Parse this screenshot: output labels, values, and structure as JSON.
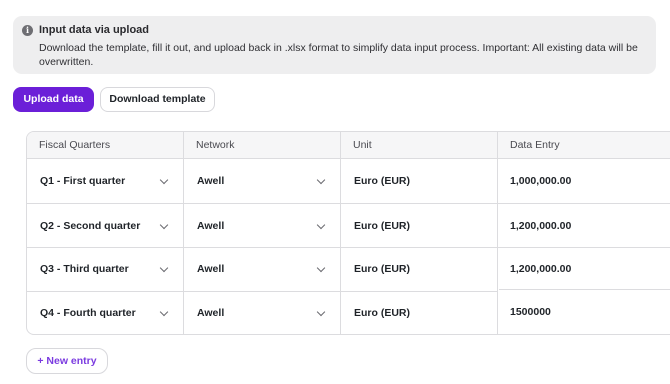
{
  "info": {
    "icon": "info-icon",
    "title": "Input data via upload",
    "text": "Download the template, fill it out, and upload back in .xlsx format to simplify data input process. Important: All existing data will be overwritten."
  },
  "actions": {
    "upload_label": "Upload data",
    "download_label": "Download template",
    "new_entry_label": "+ New entry"
  },
  "colors": {
    "primary": "#6b1fd8",
    "new_entry_text": "#7b3be0"
  },
  "table": {
    "headers": [
      "Fiscal Quarters",
      "Network",
      "Unit",
      "Data Entry"
    ],
    "rows": [
      {
        "quarter": "Q1 - First quarter",
        "network": "Awell",
        "unit": "Euro (EUR)",
        "value": "1,000,000.00"
      },
      {
        "quarter": "Q2 - Second quarter",
        "network": "Awell",
        "unit": "Euro (EUR)",
        "value": "1,200,000.00"
      },
      {
        "quarter": "Q3 - Third quarter",
        "network": "Awell",
        "unit": "Euro (EUR)",
        "value": "1,200,000.00"
      },
      {
        "quarter": "Q4 - Fourth quarter",
        "network": "Awell",
        "unit": "Euro (EUR)",
        "value": "1500000"
      }
    ]
  }
}
